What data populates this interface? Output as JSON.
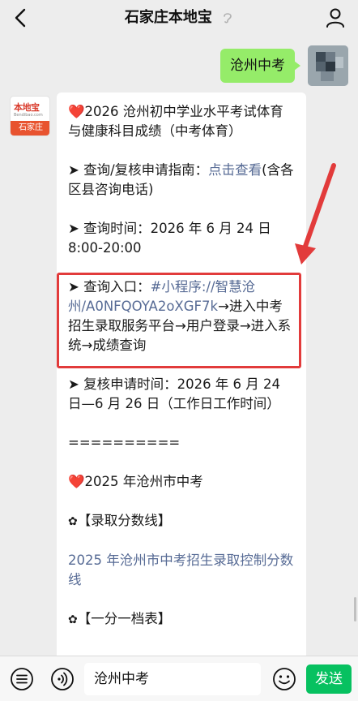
{
  "header": {
    "title": "石家庄本地宝"
  },
  "user_message": "沧州中考",
  "bot_avatar": {
    "brand": "本地宝",
    "domain": "Bendibao.com",
    "city": "石家庄"
  },
  "bot_message": {
    "p1_heart": "❤️",
    "p1": "2026 沧州初中学业水平考试体育与健康科目成绩（中考体育）",
    "p2_prefix": "➤ 查询/复核申请指南：",
    "p2_link": "点击查看",
    "p2_suffix": "(含各区县咨询电话)",
    "p3": "➤ 查询时间：2026 年 6 月 24 日 8:00-20:00",
    "p4_prefix": "➤ 查询入口：",
    "p4_link": "#小程序://智慧沧州/A0NFQOYA2oXGF7k",
    "p4_suffix": "→进入中考招生录取服务平台→用户登录→进入系统→成绩查询",
    "p5": "➤ 复核申请时间：2026 年 6 月 24 日—6 月 26 日（工作日工作时间）",
    "divider": "==========",
    "p6_heart": "❤️",
    "p6": "2025 年沧州市中考",
    "p7_flower": "✿",
    "p7": "【录取分数线】",
    "p8_link": "2025 年沧州市中考招生录取控制分数线",
    "p9_flower": "✿",
    "p9": "【一分一档表】"
  },
  "bottom_bar": {
    "input_value": "沧州中考",
    "send_label": "发送"
  },
  "colors": {
    "bubble_green": "#95ec69",
    "link": "#576b95",
    "send_green": "#07c160",
    "highlight_red": "#e23b3b"
  },
  "icons": [
    "back-icon",
    "ear-icon",
    "person-icon",
    "menu-icon",
    "voice-icon",
    "emoji-icon"
  ]
}
